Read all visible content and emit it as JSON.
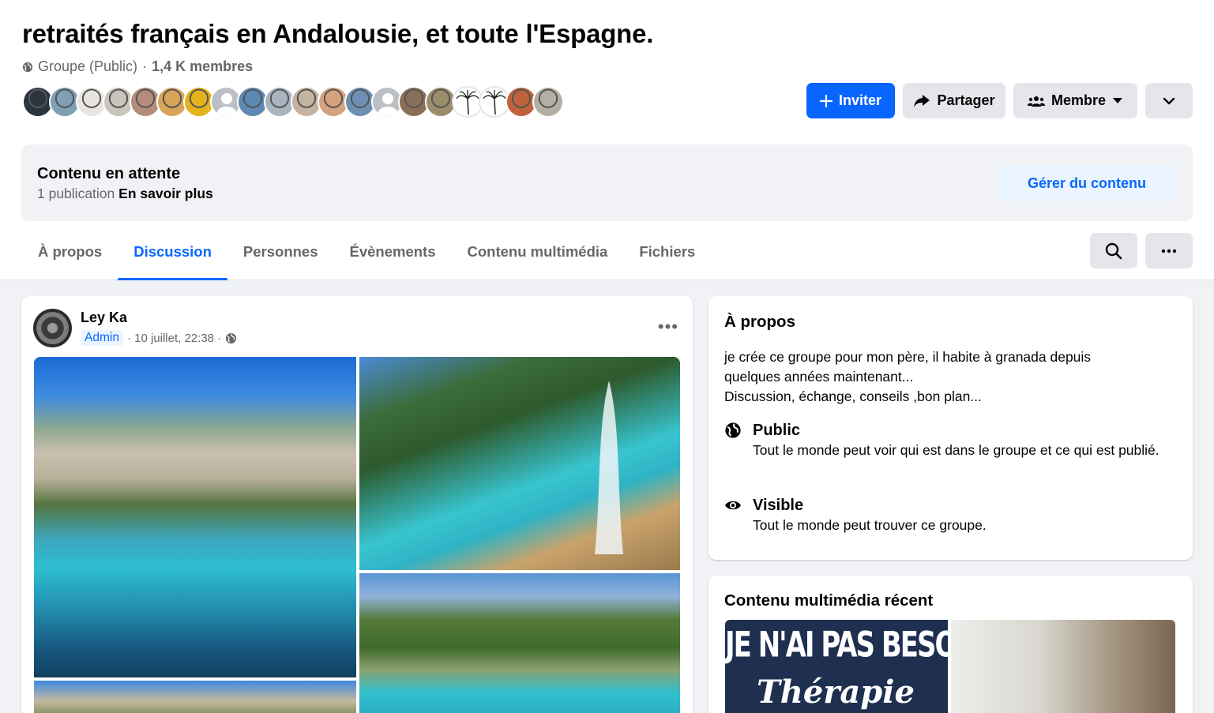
{
  "group": {
    "title": "retraités français en Andalousie, et toute l'Espagne.",
    "privacy": "Groupe (Public)",
    "separator": "·",
    "members": "1,4 K membres"
  },
  "actions": {
    "invite": "Inviter",
    "share": "Partager",
    "member": "Membre"
  },
  "pending": {
    "title": "Contenu en attente",
    "count": "1 publication",
    "learn_more": "En savoir plus",
    "manage": "Gérer du contenu"
  },
  "tabs": [
    {
      "label": "À propos"
    },
    {
      "label": "Discussion"
    },
    {
      "label": "Personnes"
    },
    {
      "label": "Évènements"
    },
    {
      "label": "Contenu multimédia"
    },
    {
      "label": "Fichiers"
    }
  ],
  "post": {
    "author": "Ley Ka",
    "badge": "Admin",
    "date": "· 10 juillet, 22:38 ·",
    "more": "•••"
  },
  "about": {
    "title": "À propos",
    "description": [
      "je crée ce groupe pour mon père, il habite à granada depuis",
      "quelques années maintenant...",
      "Discussion, échange, conseils ,bon plan..."
    ],
    "public_label": "Public",
    "public_desc": "Tout le monde peut voir qui est dans le groupe et ce qui est publié.",
    "visible_label": "Visible",
    "visible_desc": "Tout le monde peut trouver ce groupe."
  },
  "media": {
    "title": "Contenu multimédia récent",
    "thumb_text": "JE N'AI PAS BESOIN DE",
    "thumb_script": "Thérapie"
  },
  "colors": {
    "accent": "#0866ff",
    "background": "#f0f2f5",
    "secondary_text": "#65676b"
  },
  "member_avatar_colors": [
    "#2c3440",
    "#7f9fb5",
    "#e8e5e0",
    "#c9c4bc",
    "#b58c7a",
    "#d7a45a",
    "#e3b21c",
    "gray",
    "#5b89b3",
    "#a8b4bf",
    "#c3b3a0",
    "#d4a27d",
    "#6d8fb3",
    "gray",
    "#8a6f58",
    "#9b8d6a",
    "palm",
    "palm",
    "#c0623e",
    "#b4aea4"
  ]
}
